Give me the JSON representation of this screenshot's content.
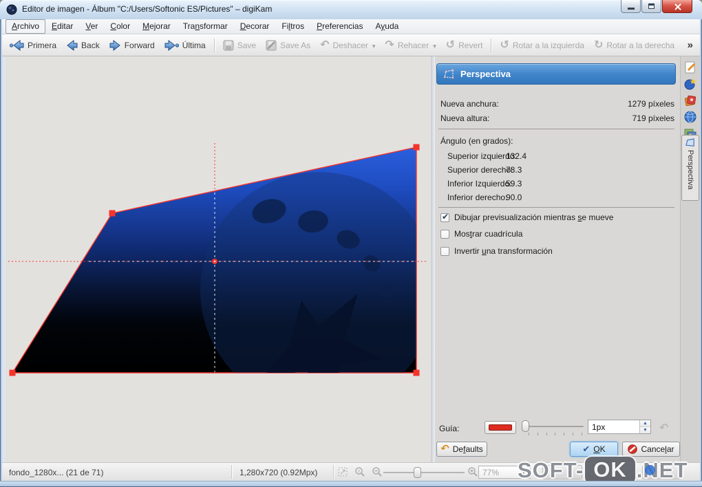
{
  "window": {
    "title": "Editor de imagen - Álbum \"C:/Users/Softonic ES/Pictures\" – digiKam"
  },
  "menu": {
    "items": [
      {
        "pre": "",
        "u": "A",
        "post": "rchivo"
      },
      {
        "pre": "",
        "u": "E",
        "post": "ditar"
      },
      {
        "pre": "",
        "u": "V",
        "post": "er"
      },
      {
        "pre": "",
        "u": "C",
        "post": "olor"
      },
      {
        "pre": "",
        "u": "M",
        "post": "ejorar"
      },
      {
        "pre": "Tra",
        "u": "n",
        "post": "sformar"
      },
      {
        "pre": "",
        "u": "D",
        "post": "ecorar"
      },
      {
        "pre": "Fi",
        "u": "l",
        "post": "tros"
      },
      {
        "pre": "",
        "u": "P",
        "post": "referencias"
      },
      {
        "pre": "A",
        "u": "y",
        "post": "uda"
      }
    ]
  },
  "toolbar": {
    "buttons": [
      {
        "label": "Primera",
        "icon": "go-first-icon",
        "enabled": true
      },
      {
        "label": "Back",
        "icon": "go-back-icon",
        "enabled": true
      },
      {
        "label": "Forward",
        "icon": "go-forward-icon",
        "enabled": true
      },
      {
        "label": "Última",
        "icon": "go-last-icon",
        "enabled": true
      },
      {
        "label": "Save",
        "icon": "save-icon",
        "enabled": false
      },
      {
        "label": "Save As",
        "icon": "save-as-icon",
        "enabled": false
      },
      {
        "label": "Deshacer",
        "icon": "undo-icon",
        "enabled": false,
        "dropdown": true
      },
      {
        "label": "Rehacer",
        "icon": "redo-icon",
        "enabled": false,
        "dropdown": true
      },
      {
        "label": "Revert",
        "icon": "revert-icon",
        "enabled": false
      },
      {
        "label": "Rotar a la izquierda",
        "icon": "rotate-left-icon",
        "enabled": false
      },
      {
        "label": "Rotar a la derecha",
        "icon": "rotate-right-icon",
        "enabled": false
      }
    ],
    "overflow_label": "»"
  },
  "panel": {
    "header": {
      "title": "Perspectiva",
      "icon": "perspective-icon"
    },
    "fields": [
      {
        "label": "Nueva anchura:",
        "value": "1279 píxeles"
      },
      {
        "label": "Nueva altura:",
        "value": "719 píxeles"
      }
    ],
    "angles": {
      "title": "Ángulo (en grados):",
      "rows": [
        {
          "label": "Superior izquierdo:",
          "value": "132.4"
        },
        {
          "label": "Superior derecho:",
          "value": "78.3"
        },
        {
          "label": "Inferior Izquierdo:",
          "value": "59.3"
        },
        {
          "label": "Inferior derecho:",
          "value": "90.0"
        }
      ]
    },
    "checkboxes": [
      {
        "pre": "Dibujar previsualización mientras ",
        "u": "s",
        "post": "e mueve",
        "checked": true
      },
      {
        "pre": "Mos",
        "u": "t",
        "post": "rar cuadrícula",
        "checked": false
      },
      {
        "pre": "Invertir ",
        "u": "u",
        "post": "na transformación",
        "checked": false
      }
    ],
    "guide": {
      "label": "Guía:",
      "color": "#e02b20",
      "value": "1px"
    },
    "buttons": {
      "defaults": {
        "pre": "De",
        "u": "f",
        "post": "aults"
      },
      "ok": {
        "pre": "",
        "u": "O",
        "post": "K"
      },
      "cancel": {
        "pre": "Cance",
        "u": "l",
        "post": "ar"
      }
    }
  },
  "sidebar": {
    "active_tab": "Perspectiva",
    "icons": [
      "properties-icon",
      "metadata-icon",
      "colors-icon",
      "geolocation-icon",
      "versions-icon"
    ]
  },
  "statusbar": {
    "file_label": "fondo_1280x... (21 de 71)",
    "size_label": "1,280x720 (0.92Mpx)",
    "zoom_value": "77%"
  },
  "watermark": {
    "left": "SOFT-",
    "badge": "OK",
    "right": ".NET"
  }
}
